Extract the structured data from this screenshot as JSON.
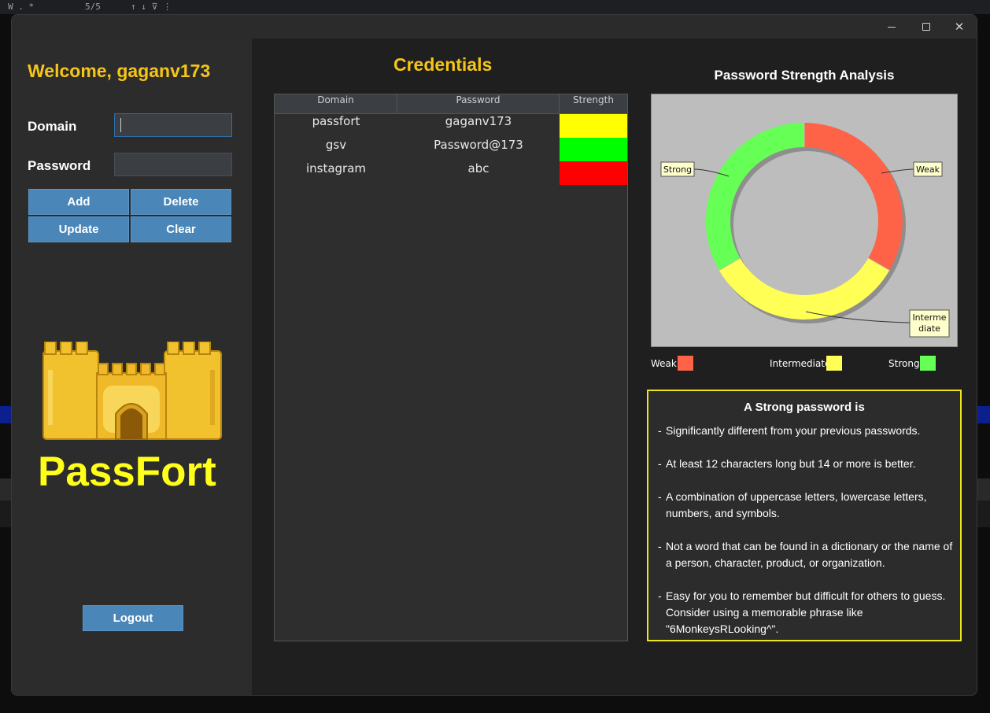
{
  "app": {
    "welcome": "Welcome, gaganv173",
    "brand": "PassFort"
  },
  "form": {
    "domain_label": "Domain",
    "password_label": "Password",
    "domain_value": "",
    "password_value": "",
    "buttons": {
      "add": "Add",
      "delete": "Delete",
      "update": "Update",
      "clear": "Clear"
    },
    "logout": "Logout"
  },
  "credentials": {
    "title": "Credentials",
    "columns": [
      "Domain",
      "Password",
      "Strength"
    ],
    "rows": [
      {
        "domain": "passfort",
        "password": "gaganv173",
        "strength": "Intermediate",
        "color": "#ffff00"
      },
      {
        "domain": "gsv",
        "password": "Password@173",
        "strength": "Strong",
        "color": "#00ff00"
      },
      {
        "domain": "instagram",
        "password": "abc",
        "strength": "Weak",
        "color": "#ff0000"
      }
    ]
  },
  "chart": {
    "title": "Password Strength Analysis",
    "slice_labels": {
      "weak": "Weak",
      "intermediate": "Interme\ndiate",
      "strong": "Strong"
    },
    "legend": [
      {
        "label": "Weak",
        "color": "#ff6347"
      },
      {
        "label": "Intermediate",
        "color": "#ffff55"
      },
      {
        "label": "Strong",
        "color": "#66ff55"
      }
    ]
  },
  "chart_data": {
    "type": "pie",
    "title": "Password Strength Analysis",
    "categories": [
      "Weak",
      "Intermediate",
      "Strong"
    ],
    "values": [
      1,
      1,
      1
    ],
    "colors": [
      "#ff6347",
      "#ffff55",
      "#66ff55"
    ],
    "legend_position": "bottom"
  },
  "info": {
    "title": "A Strong password is",
    "items": [
      "Significantly different from your previous passwords.",
      "At least 12 characters long but 14 or more is better.",
      "A combination of uppercase letters, lowercase letters, numbers, and symbols.",
      "Not a word that can be found in a dictionary or the name of a person, character, product, or organization.",
      "Easy for you to remember but difficult for others to guess. Consider using a memorable phrase like \"6MonkeysRLooking^\"."
    ]
  }
}
